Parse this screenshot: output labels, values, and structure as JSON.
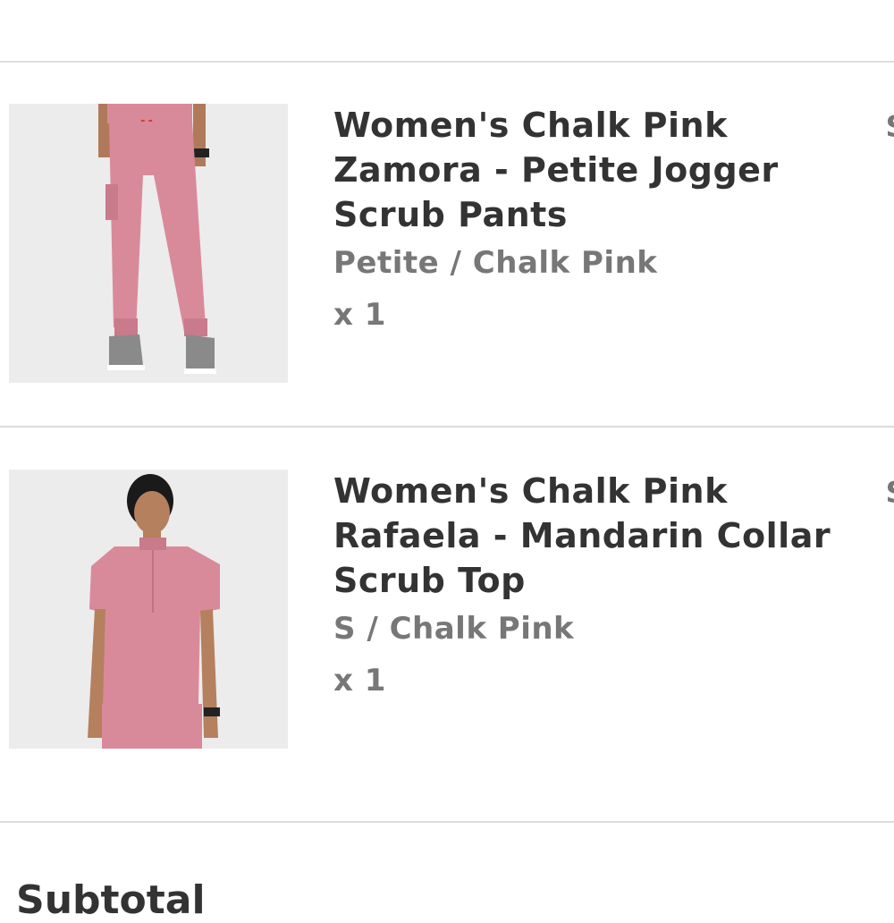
{
  "cart": {
    "items": [
      {
        "title": "Women's Chalk Pink Zamora - Petite Jogger Scrub Pants",
        "variant": "Petite / Chalk Pink",
        "quantity": "x 1",
        "price_peek": "$",
        "image_label": "jogger-pants-photo"
      },
      {
        "title": "Women's Chalk Pink Rafaela - Mandarin Collar Scrub Top",
        "variant": "S / Chalk Pink",
        "quantity": "x 1",
        "price_peek": "$",
        "image_label": "scrub-top-photo"
      }
    ],
    "subtotal_label_peek": "Subtotal"
  },
  "colors": {
    "product_pink": "#d98a9a",
    "title_text": "#333333",
    "secondary_text": "#777777",
    "divider": "#dcdcdc",
    "image_bg": "#ececec"
  }
}
